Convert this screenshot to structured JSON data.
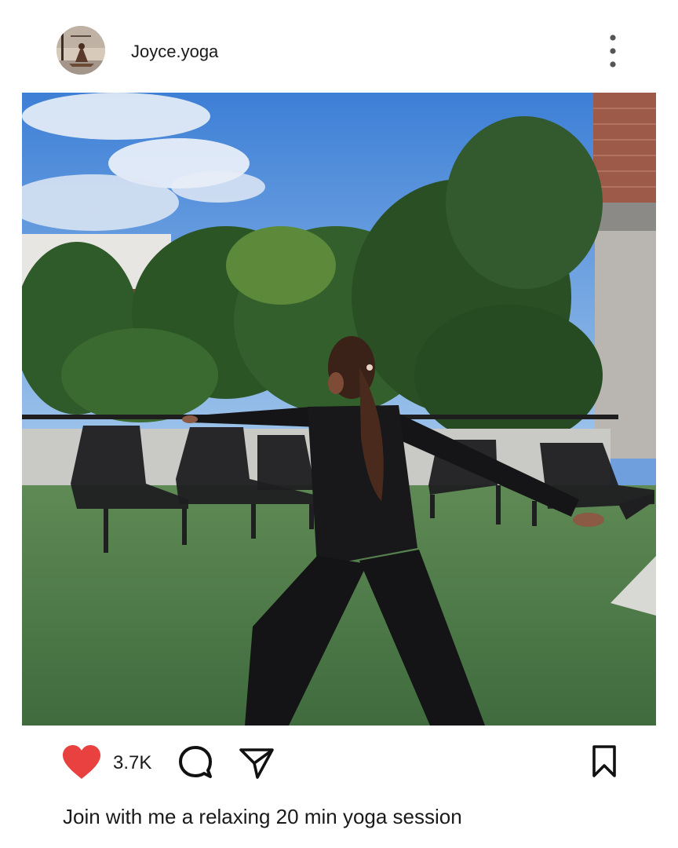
{
  "post": {
    "username": "Joyce.yoga",
    "like_count": "3.7K",
    "caption": "Join with me a relaxing 20 min yoga session"
  },
  "icons": {
    "avatar": "profile-photo",
    "more": "vertical-ellipsis-icon",
    "like": "heart-icon",
    "comment": "speech-bubble-icon",
    "share": "paper-plane-icon",
    "save": "bookmark-icon"
  },
  "colors": {
    "like_heart": "#e8413f",
    "icon_stroke": "#111111",
    "text": "#1a1a1a"
  }
}
